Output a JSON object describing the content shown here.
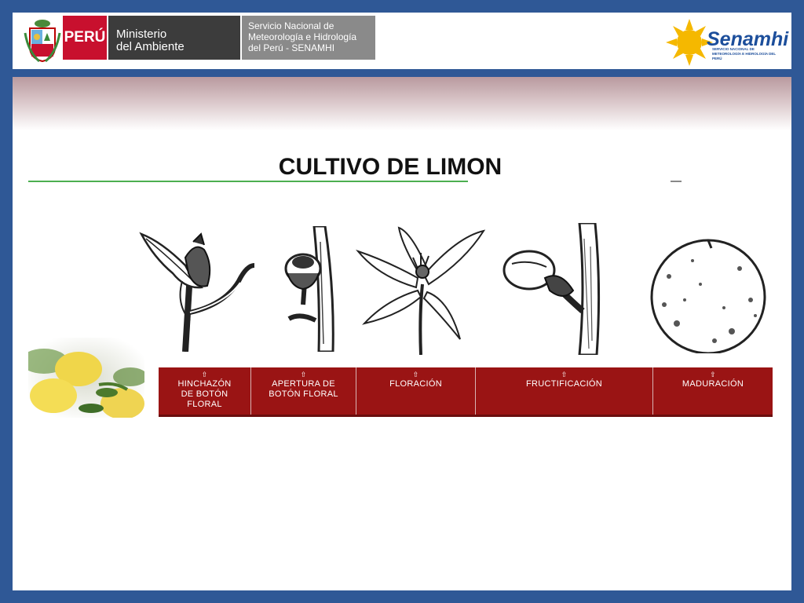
{
  "header": {
    "peru_label": "PERÚ",
    "ministry_lines": [
      "Ministerio",
      "del Ambiente"
    ],
    "service_lines": [
      "Servicio Nacional de",
      "Meteorología e Hidrología",
      "del Perú - SENAMHI"
    ],
    "logo_word": "Senamhi",
    "logo_subtitle": "SERVICIO NACIONAL DE METEOROLOGÍA E HIDROLOGÍA DEL PERÚ"
  },
  "title": "CULTIVO DE LIMON",
  "stages": [
    {
      "arrow": "⇧",
      "lines": [
        "HINCHAZÓN",
        "DE BOTÓN",
        "FLORAL"
      ]
    },
    {
      "arrow": "⇧",
      "lines": [
        "APERTURA DE",
        "BOTÓN FLORAL"
      ]
    },
    {
      "arrow": "⇧",
      "lines": [
        "FLORACIÓN"
      ]
    },
    {
      "arrow": "⇧",
      "lines": [
        "FRUCTIFICACIÓN"
      ]
    },
    {
      "arrow": "⇧",
      "lines": [
        "MADURACIÓN"
      ]
    }
  ],
  "colors": {
    "frame": "#2f5896",
    "stage_bar": "#9a1414",
    "title_underline": "#4caf50",
    "peru_red": "#c8102e"
  }
}
